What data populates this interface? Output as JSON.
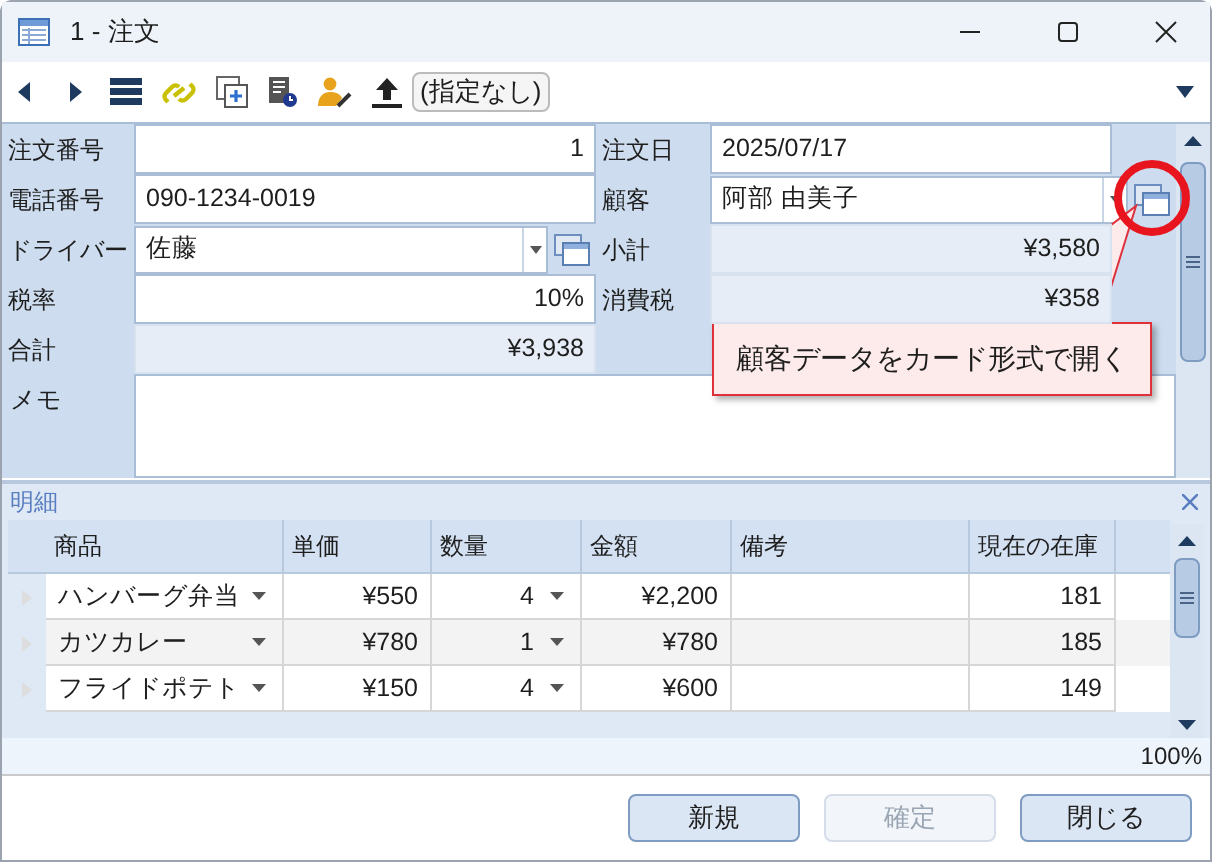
{
  "window": {
    "title": "1 - 注文"
  },
  "toolbar": {
    "filter": "(指定なし)"
  },
  "form": {
    "left": [
      {
        "label": "注文番号",
        "value": "1",
        "kind": "number"
      },
      {
        "label": "電話番号",
        "value": "090-1234-0019",
        "kind": "text"
      },
      {
        "label": "ドライバー",
        "value": "佐藤",
        "kind": "combo"
      },
      {
        "label": "税率",
        "value": "10%",
        "kind": "number"
      },
      {
        "label": "合計",
        "value": "¥3,938",
        "kind": "readonly"
      }
    ],
    "right": [
      {
        "label": "注文日",
        "value": "2025/07/17",
        "kind": "text"
      },
      {
        "label": "顧客",
        "value": "阿部 由美子",
        "kind": "combo"
      },
      {
        "label": "小計",
        "value": "¥3,580",
        "kind": "readonly"
      },
      {
        "label": "消費税",
        "value": "¥358",
        "kind": "readonly"
      }
    ],
    "memo_label": "メモ",
    "tooltip": "顧客データをカード形式で開く"
  },
  "detail": {
    "title": "明細",
    "columns": [
      {
        "label": "商品",
        "kind": "combo"
      },
      {
        "label": "単価",
        "kind": "number"
      },
      {
        "label": "数量",
        "kind": "number_combo"
      },
      {
        "label": "金額",
        "kind": "number"
      },
      {
        "label": "備考",
        "kind": "text"
      },
      {
        "label": "現在の在庫",
        "kind": "number"
      }
    ],
    "rows": [
      [
        "ハンバーグ弁当",
        "¥550",
        "4",
        "¥2,200",
        null,
        "181"
      ],
      [
        "カツカレー",
        "¥780",
        "1",
        "¥780",
        null,
        "185"
      ],
      [
        "フライドポテト",
        "¥150",
        "4",
        "¥600",
        null,
        "149"
      ]
    ],
    "zoom": "100%"
  },
  "buttons": [
    {
      "label": "新規",
      "disabled": false
    },
    {
      "label": "確定",
      "disabled": true
    },
    {
      "label": "閉じる",
      "disabled": false
    }
  ]
}
